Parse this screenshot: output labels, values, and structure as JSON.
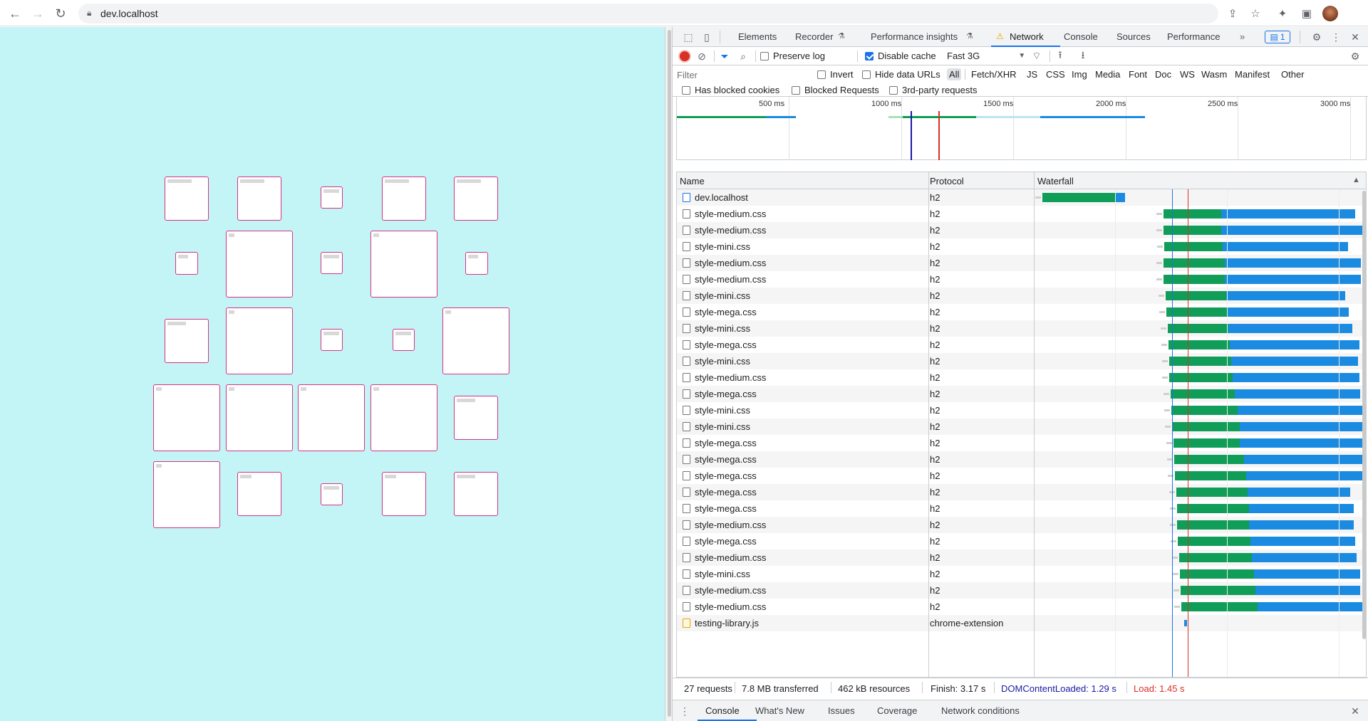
{
  "browser": {
    "url": "dev.localhost",
    "icons": [
      "back-arrow-icon",
      "forward-arrow-icon",
      "reload-icon",
      "lock-icon",
      "share-icon",
      "star-icon",
      "extensions-icon",
      "side-panel-icon",
      "avatar"
    ]
  },
  "devtools": {
    "tabs": [
      "Elements",
      "Recorder",
      "Performance insights",
      "Network",
      "Console",
      "Sources",
      "Performance"
    ],
    "active_tab": "Network",
    "more_tabs_glyph": "»",
    "messages_count": "1",
    "toolbar": {
      "preserve_log": "Preserve log",
      "preserve_log_checked": false,
      "disable_cache": "Disable cache",
      "disable_cache_checked": true,
      "throttling": "Fast 3G"
    },
    "filter": {
      "placeholder": "Filter",
      "invert": "Invert",
      "hide_data_urls": "Hide data URLs",
      "types": [
        "All",
        "Fetch/XHR",
        "JS",
        "CSS",
        "Img",
        "Media",
        "Font",
        "Doc",
        "WS",
        "Wasm",
        "Manifest",
        "Other"
      ],
      "selected_type": "All",
      "has_blocked_cookies": "Has blocked cookies",
      "blocked_requests": "Blocked Requests",
      "third_party": "3rd-party requests"
    },
    "overview": {
      "ticks": [
        "500 ms",
        "1000 ms",
        "1500 ms",
        "2000 ms",
        "2500 ms",
        "3000 ms"
      ]
    },
    "table": {
      "columns": [
        "Name",
        "Protocol",
        "Waterfall"
      ],
      "sort_glyph": "▲",
      "rows": [
        {
          "name": "dev.localhost",
          "protocol": "h2",
          "type": "doc"
        },
        {
          "name": "style-medium.css",
          "protocol": "h2",
          "type": "css"
        },
        {
          "name": "style-medium.css",
          "protocol": "h2",
          "type": "css"
        },
        {
          "name": "style-mini.css",
          "protocol": "h2",
          "type": "css"
        },
        {
          "name": "style-medium.css",
          "protocol": "h2",
          "type": "css"
        },
        {
          "name": "style-medium.css",
          "protocol": "h2",
          "type": "css"
        },
        {
          "name": "style-mini.css",
          "protocol": "h2",
          "type": "css"
        },
        {
          "name": "style-mega.css",
          "protocol": "h2",
          "type": "css"
        },
        {
          "name": "style-mini.css",
          "protocol": "h2",
          "type": "css"
        },
        {
          "name": "style-mega.css",
          "protocol": "h2",
          "type": "css"
        },
        {
          "name": "style-mini.css",
          "protocol": "h2",
          "type": "css"
        },
        {
          "name": "style-medium.css",
          "protocol": "h2",
          "type": "css"
        },
        {
          "name": "style-mega.css",
          "protocol": "h2",
          "type": "css"
        },
        {
          "name": "style-mini.css",
          "protocol": "h2",
          "type": "css"
        },
        {
          "name": "style-mini.css",
          "protocol": "h2",
          "type": "css"
        },
        {
          "name": "style-mega.css",
          "protocol": "h2",
          "type": "css"
        },
        {
          "name": "style-mega.css",
          "protocol": "h2",
          "type": "css"
        },
        {
          "name": "style-mega.css",
          "protocol": "h2",
          "type": "css"
        },
        {
          "name": "style-mega.css",
          "protocol": "h2",
          "type": "css"
        },
        {
          "name": "style-mega.css",
          "protocol": "h2",
          "type": "css"
        },
        {
          "name": "style-medium.css",
          "protocol": "h2",
          "type": "css"
        },
        {
          "name": "style-mega.css",
          "protocol": "h2",
          "type": "css"
        },
        {
          "name": "style-medium.css",
          "protocol": "h2",
          "type": "css"
        },
        {
          "name": "style-mini.css",
          "protocol": "h2",
          "type": "css"
        },
        {
          "name": "style-medium.css",
          "protocol": "h2",
          "type": "css"
        },
        {
          "name": "style-medium.css",
          "protocol": "h2",
          "type": "css"
        },
        {
          "name": "testing-library.js",
          "protocol": "chrome-extension",
          "type": "js"
        }
      ]
    },
    "summary": {
      "requests": "27 requests",
      "transferred": "7.8 MB transferred",
      "resources": "462 kB resources",
      "finish": "Finish: 3.17 s",
      "dcl": "DOMContentLoaded: 1.29 s",
      "load": "Load: 1.45 s"
    },
    "drawer_tabs": [
      "Console",
      "What's New",
      "Issues",
      "Coverage",
      "Network conditions"
    ],
    "drawer_active": "Console",
    "colors": {
      "accent": "#1a73e8",
      "waiting": "#0f9d58",
      "download": "#1a8be0",
      "dcl": "#1a1aa6",
      "load": "#d93025"
    }
  },
  "page": {
    "background": "#c3f4f6",
    "box_border": "#d63384"
  }
}
